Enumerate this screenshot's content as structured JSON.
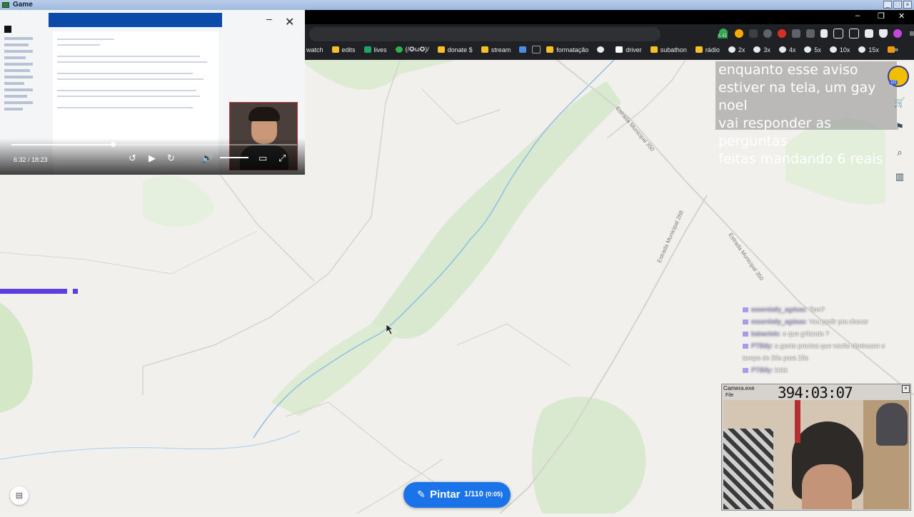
{
  "window": {
    "title": "Game",
    "controls": [
      "_",
      "□",
      "×"
    ]
  },
  "browser": {
    "bookmarks": [
      {
        "label": "watch",
        "icon": "none",
        "color": "#202124"
      },
      {
        "label": "edits",
        "icon": "folder-icon",
        "color": "#f6c026"
      },
      {
        "label": "lives",
        "icon": "sheet-icon",
        "color": "#1fa463"
      },
      {
        "label": "(/✪ω✪)/",
        "icon": "leaf-icon",
        "color": "#2bb34a"
      },
      {
        "label": "donate $",
        "icon": "folder-icon",
        "color": "#f6c026"
      },
      {
        "label": "stream",
        "icon": "folder-icon",
        "color": "#f6c026"
      },
      {
        "label": "",
        "icon": "tv-icon",
        "color": "#4a8fe7"
      },
      {
        "label": "",
        "icon": "grid-icon",
        "color": "#9aa0a6"
      },
      {
        "label": "formatação",
        "icon": "folder-icon",
        "color": "#f6c026"
      },
      {
        "label": "",
        "icon": "ban-icon",
        "color": "#e8eaed"
      },
      {
        "label": "driver",
        "icon": "page-icon",
        "color": "#ffffff"
      },
      {
        "label": "subathon",
        "icon": "folder-icon",
        "color": "#f6c026"
      },
      {
        "label": "rádio",
        "icon": "folder-icon",
        "color": "#f6c026"
      },
      {
        "label": "2x",
        "icon": "ban-icon",
        "color": "#e8eaed"
      },
      {
        "label": "3x",
        "icon": "ban-icon",
        "color": "#e8eaed"
      },
      {
        "label": "4x",
        "icon": "ban-icon",
        "color": "#e8eaed"
      },
      {
        "label": "5x",
        "icon": "ban-icon",
        "color": "#e8eaed"
      },
      {
        "label": "10x",
        "icon": "ban-icon",
        "color": "#e8eaed"
      },
      {
        "label": "15x",
        "icon": "ban-icon",
        "color": "#e8eaed"
      },
      {
        "label": "",
        "icon": "forward-icon",
        "color": "#f29900"
      }
    ],
    "badge": "5.43",
    "more": "»"
  },
  "video": {
    "time": "6:32 / 18:23",
    "progress": 0.356
  },
  "overlay": {
    "text_lines": [
      "enquanto esse aviso",
      "estiver na tela, um gay noel",
      "vai responder as perguntas",
      "feitas mandando 6 reais"
    ]
  },
  "map": {
    "roads": [
      "Estrada Municipal 350",
      "Estrada Municipal 268",
      "Estrada Municipal 350"
    ]
  },
  "chat": [
    {
      "user": "essentially_agdsas",
      "text": ": Tem?"
    },
    {
      "user": "essentially_agdsas",
      "text": ": Vou pedir pra checar"
    },
    {
      "user": "babacbds",
      "text": ": o que grifando ?"
    },
    {
      "user": "PTBilly",
      "text": ": a gente precisa que vocês diminuam o tempo de 30s para 15s"
    },
    {
      "user": "PTBilly",
      "text": ": kkkk"
    }
  ],
  "camera": {
    "title": "Camera.exe",
    "menu": "File",
    "clock": "394:03:07"
  },
  "pintar": {
    "label": "Pintar",
    "count": "1/110",
    "timer": "(0:05)"
  },
  "side_badge": "10",
  "colors": {
    "accent": "#1a73e8",
    "purple": "#5b3fe0",
    "water": "#7fb3e0",
    "green": "#d4e8c8"
  }
}
